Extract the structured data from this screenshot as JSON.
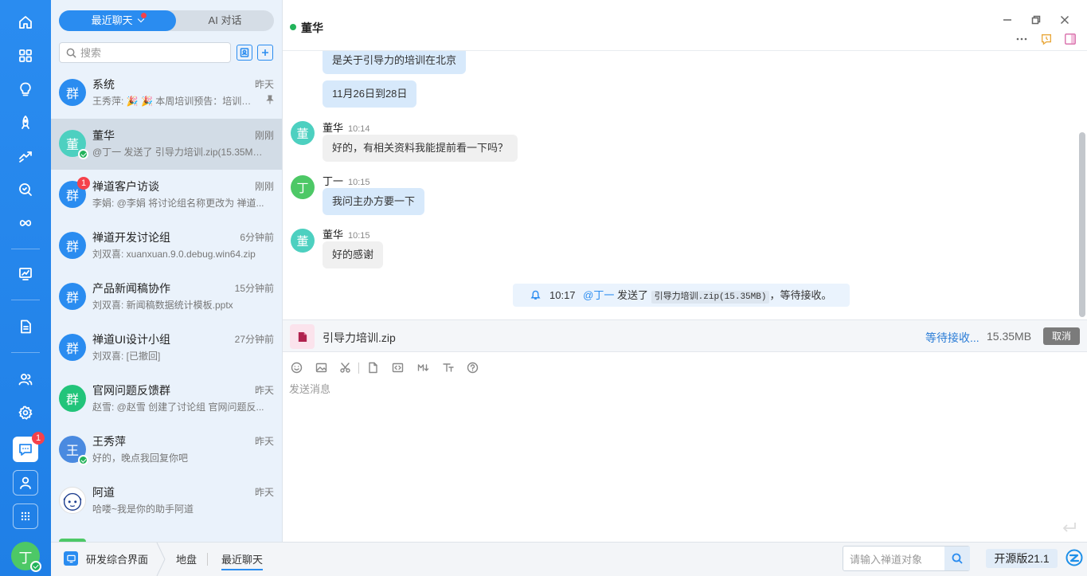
{
  "rail": {
    "chat_badge": "1",
    "user_avatar": "丁"
  },
  "list": {
    "tabs": {
      "recent": "最近聊天",
      "ai": "AI 对话"
    },
    "search_placeholder": "搜索",
    "items": [
      {
        "avatar": "群",
        "avatar_color": "#2a8cf0",
        "name": "系统",
        "time": "昨天",
        "preview": "王秀萍: 🎉 🎉 本周培训预告：培训主题...",
        "pinned": true
      },
      {
        "avatar": "董",
        "avatar_color": "#4dd0c0",
        "name": "董华",
        "time": "刚刚",
        "preview": "@丁一 发送了 引导力培训.zip(15.35MB)...",
        "online": true
      },
      {
        "avatar": "群",
        "avatar_color": "#2a8cf0",
        "name": "禅道客户访谈",
        "time": "刚刚",
        "preview": "李娟: @李娟 将讨论组名称更改为 禅道...",
        "badge": "1"
      },
      {
        "avatar": "群",
        "avatar_color": "#2a8cf0",
        "name": "禅道开发讨论组",
        "time": "6分钟前",
        "preview": "刘双喜: xuanxuan.9.0.debug.win64.zip"
      },
      {
        "avatar": "群",
        "avatar_color": "#2a8cf0",
        "name": "产品新闻稿协作",
        "time": "15分钟前",
        "preview": "刘双喜: 新闻稿数据统计模板.pptx"
      },
      {
        "avatar": "群",
        "avatar_color": "#2a8cf0",
        "name": "禅道UI设计小组",
        "time": "27分钟前",
        "preview": "刘双喜: [已撤回]"
      },
      {
        "avatar": "群",
        "avatar_color": "#22c47a",
        "name": "官网问题反馈群",
        "time": "昨天",
        "preview": "赵雪: @赵雪 创建了讨论组 官网问题反..."
      },
      {
        "avatar": "王",
        "avatar_color": "#4a8ae0",
        "name": "王秀萍",
        "time": "昨天",
        "preview": "好的，晚点我回复你吧",
        "online": true
      },
      {
        "avatar": "",
        "avatar_color": "#ffffff",
        "name": "阿道",
        "time": "昨天",
        "preview": "哈喽~我是你的助手阿道"
      }
    ]
  },
  "chat": {
    "title": "董华",
    "messages": {
      "m1": "是关于引导力的培训在北京",
      "m2": "11月26日到28日",
      "g1_name": "董华",
      "g1_time": "10:14",
      "g1_text": "好的，有相关资料我能提前看一下吗？",
      "g2_avatar": "丁",
      "g2_name": "丁一",
      "g2_time": "10:15",
      "g2_text": "我问主办方要一下",
      "g3_avatar": "董",
      "g3_name": "董华",
      "g3_time": "10:15",
      "g3_text": "好的感谢"
    },
    "notice": {
      "time": "10:17",
      "mention": "@丁一",
      "sent": "发送了",
      "file": "引导力培训.zip(15.35MB)",
      "tail": "，等待接收。"
    },
    "file_transfer": {
      "name": "引导力培训.zip",
      "status": "等待接收...",
      "size": "15.35MB",
      "cancel": "取消"
    },
    "composer_placeholder": "发送消息"
  },
  "bottom": {
    "app": "研发综合界面",
    "crumb_1": "地盘",
    "crumb_2": "最近聊天",
    "search_placeholder": "请输入禅道对象",
    "version": "开源版21.1"
  },
  "colors": {
    "accent": "#2a8cf0",
    "online": "#22b35a",
    "badge": "#f5414b"
  }
}
